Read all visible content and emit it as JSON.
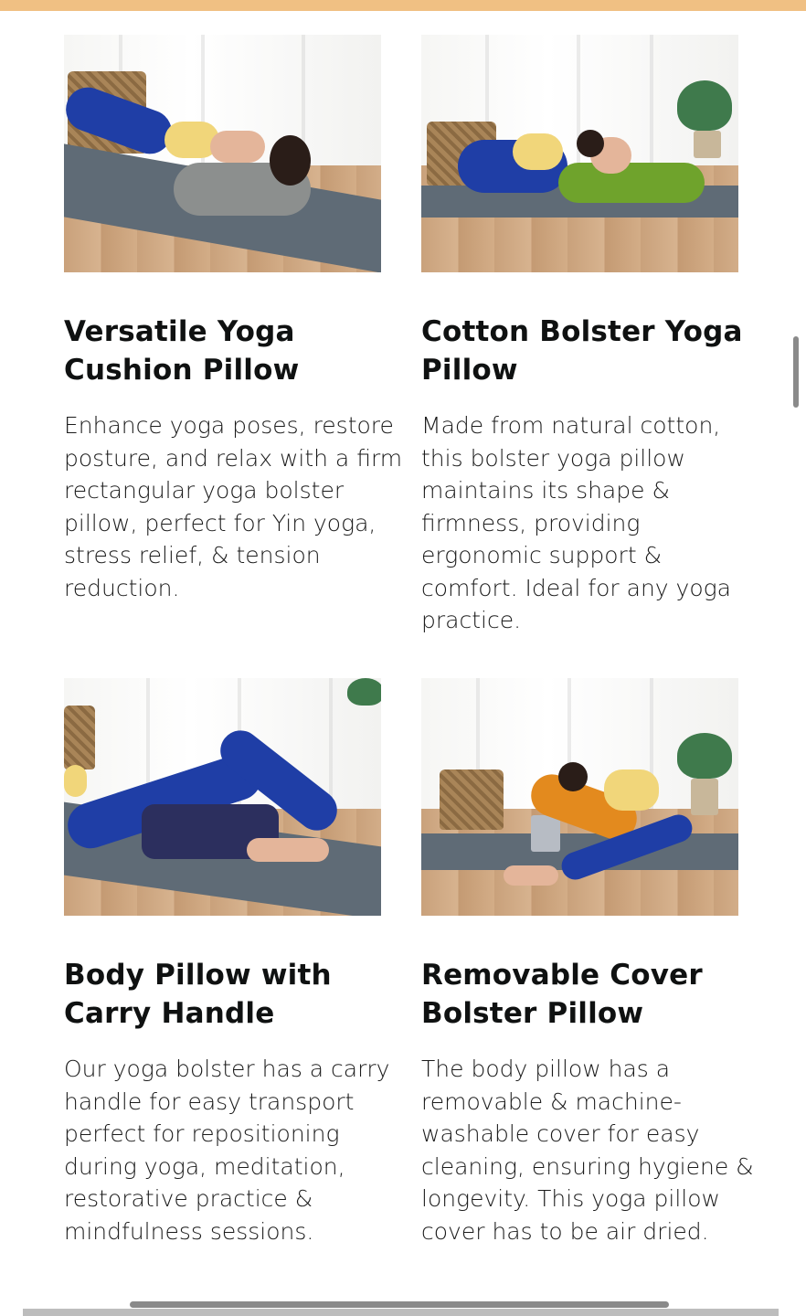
{
  "cards": [
    {
      "title": "Versatile Yoga Cushion Pillow",
      "description": "Enhance yoga poses, restore posture, and relax with a firm rectangular yoga bolster pillow, perfect for Yin yoga, stress relief, & tension reduction.",
      "image_alt": "woman lying back on gray bolster"
    },
    {
      "title": "Cotton Bolster Yoga Pillow",
      "description": "Made from natural cotton, this bolster yoga pillow maintains its shape & firmness, providing ergonomic support & comfort. Ideal for any yoga practice.",
      "image_alt": "woman resting forward on green bolster"
    },
    {
      "title": "Body Pillow with Carry Handle",
      "description": "Our yoga bolster has a carry handle for easy transport perfect for repositioning during yoga, meditation, restorative practice & mindfulness sessions.",
      "image_alt": "navy bolster under hips"
    },
    {
      "title": "Removable Cover Bolster Pillow",
      "description": "The body pillow has a removable & machine-washable cover for easy cleaning, ensuring hygiene & longevity. This yoga pillow cover has to be air dried.",
      "image_alt": "woman resting on orange bolster over blocks"
    }
  ],
  "colors": {
    "top_bar": "#f0c083",
    "gray_bolster": "#8c8f8e",
    "green_bolster": "#6fa32c",
    "navy_bolster": "#2c2f5e",
    "orange_bolster": "#e38a1e"
  }
}
